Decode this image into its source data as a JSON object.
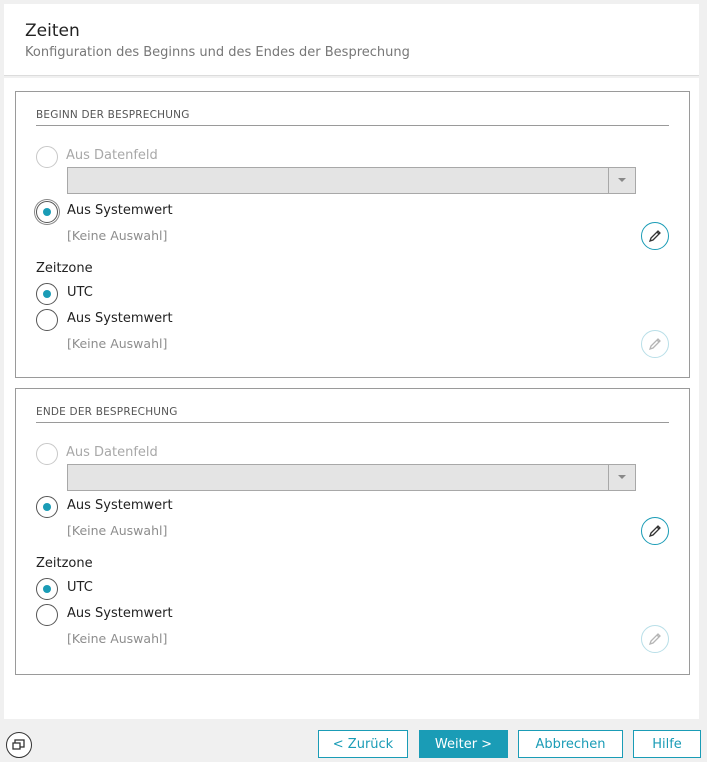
{
  "header": {
    "title": "Zeiten",
    "subtitle": "Konfiguration des Beginns und des Endes der Besprechung"
  },
  "sections": [
    {
      "title": "BEGINN DER BESPRECHUNG",
      "datafield_label": "Aus Datenfeld",
      "systemvalue_label": "Aus Systemwert",
      "systemvalue_placeholder": "[Keine Auswahl]",
      "timezone_label": "Zeitzone",
      "tz_utc_label": "UTC",
      "tz_system_label": "Aus Systemwert",
      "tz_placeholder": "[Keine Auswahl]"
    },
    {
      "title": "ENDE DER BESPRECHUNG",
      "datafield_label": "Aus Datenfeld",
      "systemvalue_label": "Aus Systemwert",
      "systemvalue_placeholder": "[Keine Auswahl]",
      "timezone_label": "Zeitzone",
      "tz_utc_label": "UTC",
      "tz_system_label": "Aus Systemwert",
      "tz_placeholder": "[Keine Auswahl]"
    }
  ],
  "footer": {
    "back_label": "< Zurück",
    "next_label": "Weiter >",
    "cancel_label": "Abbrechen",
    "help_label": "Hilfe"
  },
  "colors": {
    "accent": "#1a9cb6",
    "disabled_text": "#a8a8a8",
    "placeholder_text": "#8d8d8d"
  },
  "icons": {
    "edit": "pencil-icon",
    "footer": "window-icon"
  }
}
